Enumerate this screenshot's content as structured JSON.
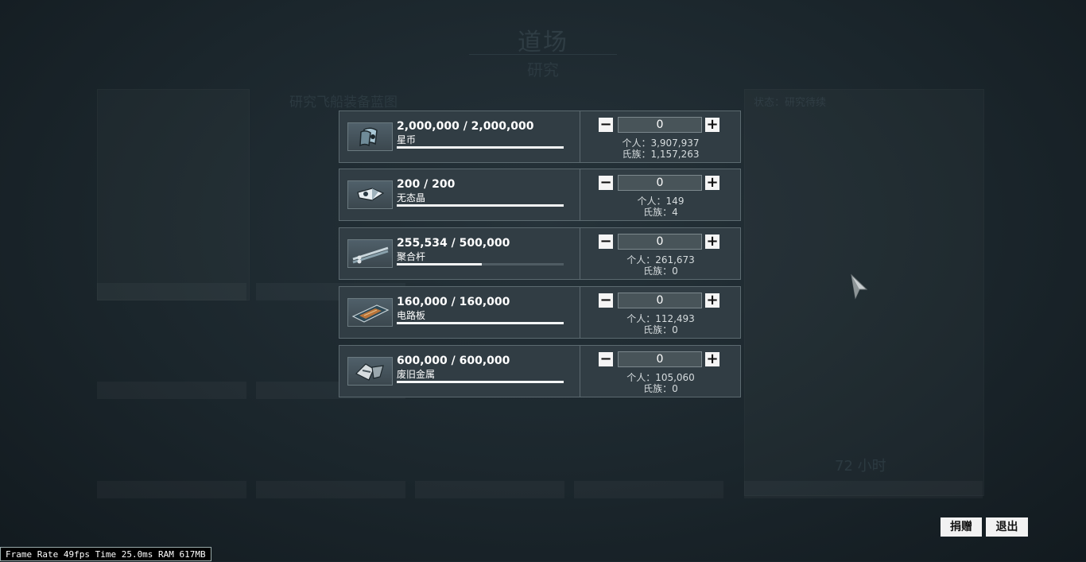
{
  "background": {
    "title": "道场",
    "subtitle": "研究",
    "research_heading": "研究飞船装备蓝图",
    "status": "状态：研究待续",
    "hours": "72 小时"
  },
  "rows": [
    {
      "icon": "credits-icon",
      "amount": "2,000,000 / 2,000,000",
      "name": "星币",
      "progress": 1.0,
      "quantity": "0",
      "personal": "个人：3,907,937",
      "clan": "氏族：1,157,263"
    },
    {
      "icon": "argon-crystal-icon",
      "amount": "200 / 200",
      "name": "无态晶",
      "progress": 1.0,
      "quantity": "0",
      "personal": "个人：149",
      "clan": "氏族：4"
    },
    {
      "icon": "polymer-bundle-icon",
      "amount": "255,534 / 500,000",
      "name": "聚合杆",
      "progress": 0.511,
      "quantity": "0",
      "personal": "个人：261,673",
      "clan": "氏族：0"
    },
    {
      "icon": "circuits-icon",
      "amount": "160,000 / 160,000",
      "name": "电路板",
      "progress": 1.0,
      "quantity": "0",
      "personal": "个人：112,493",
      "clan": "氏族：0"
    },
    {
      "icon": "salvage-icon",
      "amount": "600,000 / 600,000",
      "name": "废旧金属",
      "progress": 1.0,
      "quantity": "0",
      "personal": "个人：105,060",
      "clan": "氏族：0"
    }
  ],
  "buttons": {
    "donate": "捐赠",
    "exit": "退出"
  },
  "debug": {
    "fps_text": "Frame Rate 49fps Time 25.0ms RAM 617MB"
  }
}
